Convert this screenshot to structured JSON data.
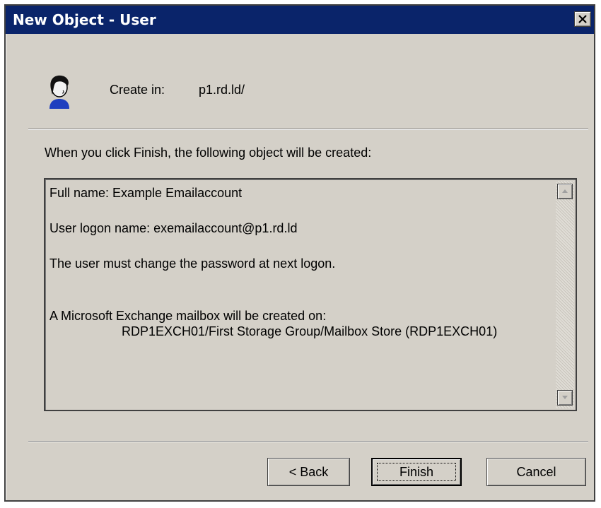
{
  "window": {
    "title": "New Object - User",
    "close_icon": "close-icon"
  },
  "header": {
    "icon": "user-icon",
    "create_in_label": "Create in:",
    "create_in_value": "p1.rd.ld/"
  },
  "summary": {
    "intro": "When you click Finish, the following object will be created:",
    "lines": [
      "Full name: Example Emailaccount",
      "User logon name: exemailaccount@p1.rd.ld",
      "The user must change the password at next logon.",
      "A Microsoft Exchange mailbox will be created on:",
      "RDP1EXCH01/First Storage Group/Mailbox Store (RDP1EXCH01)"
    ]
  },
  "buttons": {
    "back": "< Back",
    "finish": "Finish",
    "cancel": "Cancel"
  },
  "colors": {
    "titlebar": "#0a246a",
    "dialog_bg": "#d4d0c8"
  }
}
